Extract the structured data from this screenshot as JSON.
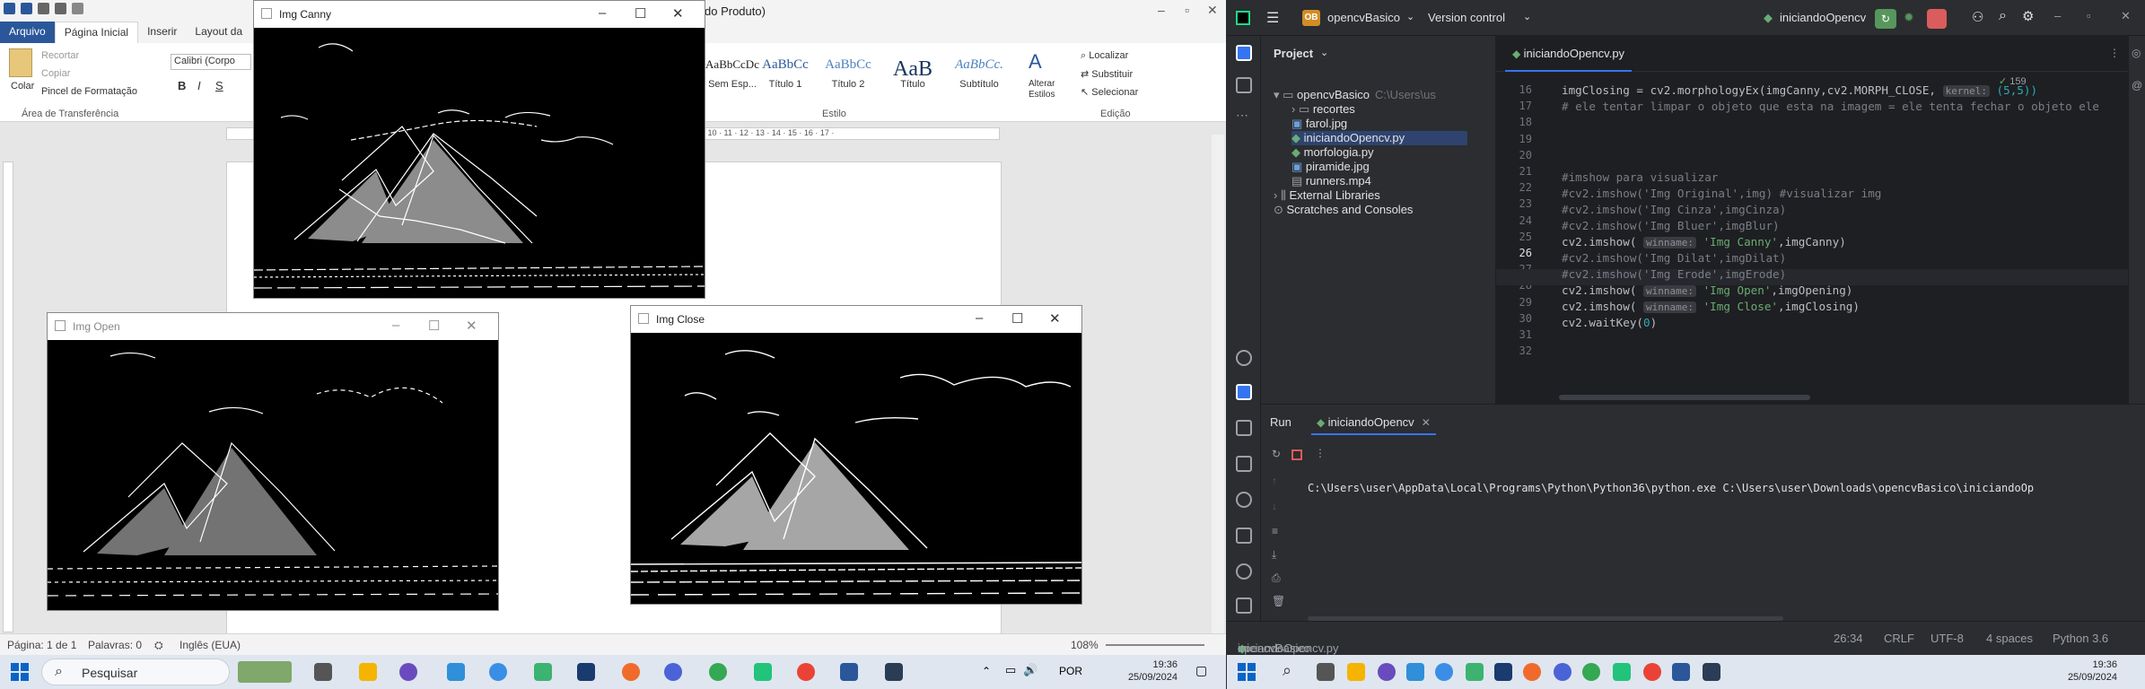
{
  "word": {
    "title": "do Produto)",
    "tabs": [
      "Arquivo",
      "Página Inicial",
      "Inserir",
      "Layout da"
    ],
    "clipboard": {
      "paste": "Colar",
      "cut": "Recortar",
      "copy": "Copiar",
      "format_painter": "Pincel de Formatação",
      "group": "Área de Transferência"
    },
    "font_name": "Calibri (Corpo",
    "styles": [
      {
        "preview": "AaBbCcDc",
        "label": "Sem Esp..."
      },
      {
        "preview": "AaBbCc",
        "label": "Título 1"
      },
      {
        "preview": "AaBbCc",
        "label": "Título 2"
      },
      {
        "preview": "AaB",
        "label": "Título"
      },
      {
        "preview": "AaBbCc.",
        "label": "Subtítulo"
      }
    ],
    "styles_group": "Estilo",
    "change_styles": "Alterar Estilos",
    "editing": {
      "find": "Localizar",
      "replace": "Substituir",
      "select": "Selecionar",
      "group": "Edição"
    },
    "ruler_marks": "· 10 · 11 · 12 · 13 · 14 · 15 · 16 · 17 ·",
    "status": {
      "page": "Página: 1 de 1",
      "words": "Palavras: 0",
      "language": "Inglês (EUA)",
      "zoom": "108%"
    }
  },
  "cv_windows": {
    "canny": "Img Canny",
    "open": "Img Open",
    "close": "Img Close"
  },
  "taskbar_left": {
    "search": "Pesquisar",
    "lang": "POR",
    "time": "19:36",
    "date": "25/09/2024"
  },
  "ide": {
    "project": "opencvBasico",
    "project_badge": "OB",
    "vcs": "Version control",
    "run_config": "iniciandoOpencv",
    "panel_title": "Project",
    "tree": [
      {
        "name": "opencvBasico",
        "extra": "C:\\Users\\us",
        "level": 0,
        "kind": "folder-open"
      },
      {
        "name": "recortes",
        "level": 1,
        "kind": "folder"
      },
      {
        "name": "farol.jpg",
        "level": 1,
        "kind": "image"
      },
      {
        "name": "iniciandoOpencv.py",
        "level": 1,
        "kind": "python",
        "selected": true
      },
      {
        "name": "morfologia.py",
        "level": 1,
        "kind": "python"
      },
      {
        "name": "piramide.jpg",
        "level": 1,
        "kind": "image"
      },
      {
        "name": "runners.mp4",
        "level": 1,
        "kind": "file"
      },
      {
        "name": "External Libraries",
        "level": 0,
        "kind": "lib"
      },
      {
        "name": "Scratches and Consoles",
        "level": 0,
        "kind": "scratch"
      }
    ],
    "editor_tab": "iniciandoOpencv.py",
    "warnings": "159",
    "lines": [
      16,
      17,
      18,
      19,
      20,
      21,
      22,
      23,
      24,
      25,
      26,
      27,
      28,
      29,
      30,
      31,
      32
    ],
    "code": {
      "l16a": "imgClosing = cv2.morphologyEx(imgCanny,cv2.MORPH_CLOSE, ",
      "l16hint": "kernel:",
      "l16b": " (5,5))",
      "l17": "# ele tentar limpar o objeto que esta na imagem = ele tenta fechar o objeto ele",
      "l20": "#imshow para visualizar",
      "l21": "#cv2.imshow('Img Original',img) #visualizar img",
      "l22": "#cv2.imshow('Img Cinza',imgCinza)",
      "l23": "#cv2.imshow('Img Bluer',imgBlur)",
      "l24a": "cv2.imshow( ",
      "hint": "winname:",
      "l24s": "'Img Canny'",
      "l24b": ",imgCanny)",
      "l25": "#cv2.imshow('Img Dilat',imgDilat)",
      "l26": "#cv2.imshow('Img Erode',imgErode)",
      "l27s": "'Img Open'",
      "l27b": ",imgOpening)",
      "l28s": "'Img Close'",
      "l28b": ",imgClosing)",
      "l29a": "cv2.waitKey(",
      "l29n": "0",
      "l29b": ")"
    },
    "run_label": "Run",
    "run_tab": "iniciandoOpencv",
    "console": "C:\\Users\\user\\AppData\\Local\\Programs\\Python\\Python36\\python.exe C:\\Users\\user\\Downloads\\opencvBasico\\iniciandoOp",
    "breadcrumb": [
      "opencvBasico",
      "iniciandoOpencv.py"
    ],
    "status": {
      "pos": "26:34",
      "eol": "CRLF",
      "enc": "UTF-8",
      "indent": "4 spaces",
      "python": "Python 3.6"
    },
    "time": "19:36",
    "date": "25/09/2024"
  }
}
